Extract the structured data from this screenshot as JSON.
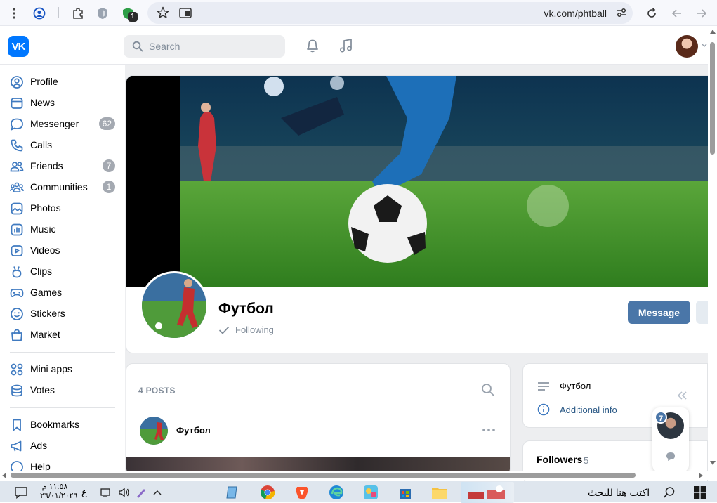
{
  "browser": {
    "url": "vk.com/phtball",
    "extension_badge": "1"
  },
  "header": {
    "logo_text": "VK",
    "search_placeholder": "Search"
  },
  "sidebar": {
    "items": [
      {
        "label": "Profile",
        "icon": "person-circle-icon"
      },
      {
        "label": "News",
        "icon": "news-feed-icon"
      },
      {
        "label": "Messenger",
        "icon": "chat-bubble-icon",
        "count": "62"
      },
      {
        "label": "Calls",
        "icon": "phone-icon"
      },
      {
        "label": "Friends",
        "icon": "friends-icon",
        "count": "7"
      },
      {
        "label": "Communities",
        "icon": "communities-icon",
        "count": "1"
      },
      {
        "label": "Photos",
        "icon": "photo-icon"
      },
      {
        "label": "Music",
        "icon": "music-bars-icon"
      },
      {
        "label": "Videos",
        "icon": "video-icon"
      },
      {
        "label": "Clips",
        "icon": "clips-icon"
      },
      {
        "label": "Games",
        "icon": "gamepad-icon"
      },
      {
        "label": "Stickers",
        "icon": "smiley-icon"
      },
      {
        "label": "Market",
        "icon": "shopping-bag-icon"
      },
      {
        "label": "Mini apps",
        "icon": "apps-grid-icon"
      },
      {
        "label": "Votes",
        "icon": "coins-icon"
      },
      {
        "label": "Bookmarks",
        "icon": "bookmark-icon"
      },
      {
        "label": "Ads",
        "icon": "megaphone-icon"
      },
      {
        "label": "Help",
        "icon": "help-icon"
      }
    ]
  },
  "group": {
    "title": "Футбол",
    "status": "Following",
    "message_button": "Message"
  },
  "posts": {
    "count_label": "4 POSTS",
    "first_post_author": "Футбол"
  },
  "info": {
    "description": "Футбол",
    "additional": "Additional info"
  },
  "followers": {
    "title": "Followers",
    "count": "5"
  },
  "chat_float": {
    "badge": "7"
  },
  "taskbar": {
    "time": "١١:٥٨ م",
    "date": "٢٦/٠١/٢٠٢٦",
    "lang": "ع",
    "search_text": "اكتب هنا للبحث"
  },
  "colors": {
    "vk_blue": "#0077ff",
    "button_blue": "#4a76a8",
    "sidebar_icon": "#3f7ac0",
    "muted_text": "#818c99"
  }
}
